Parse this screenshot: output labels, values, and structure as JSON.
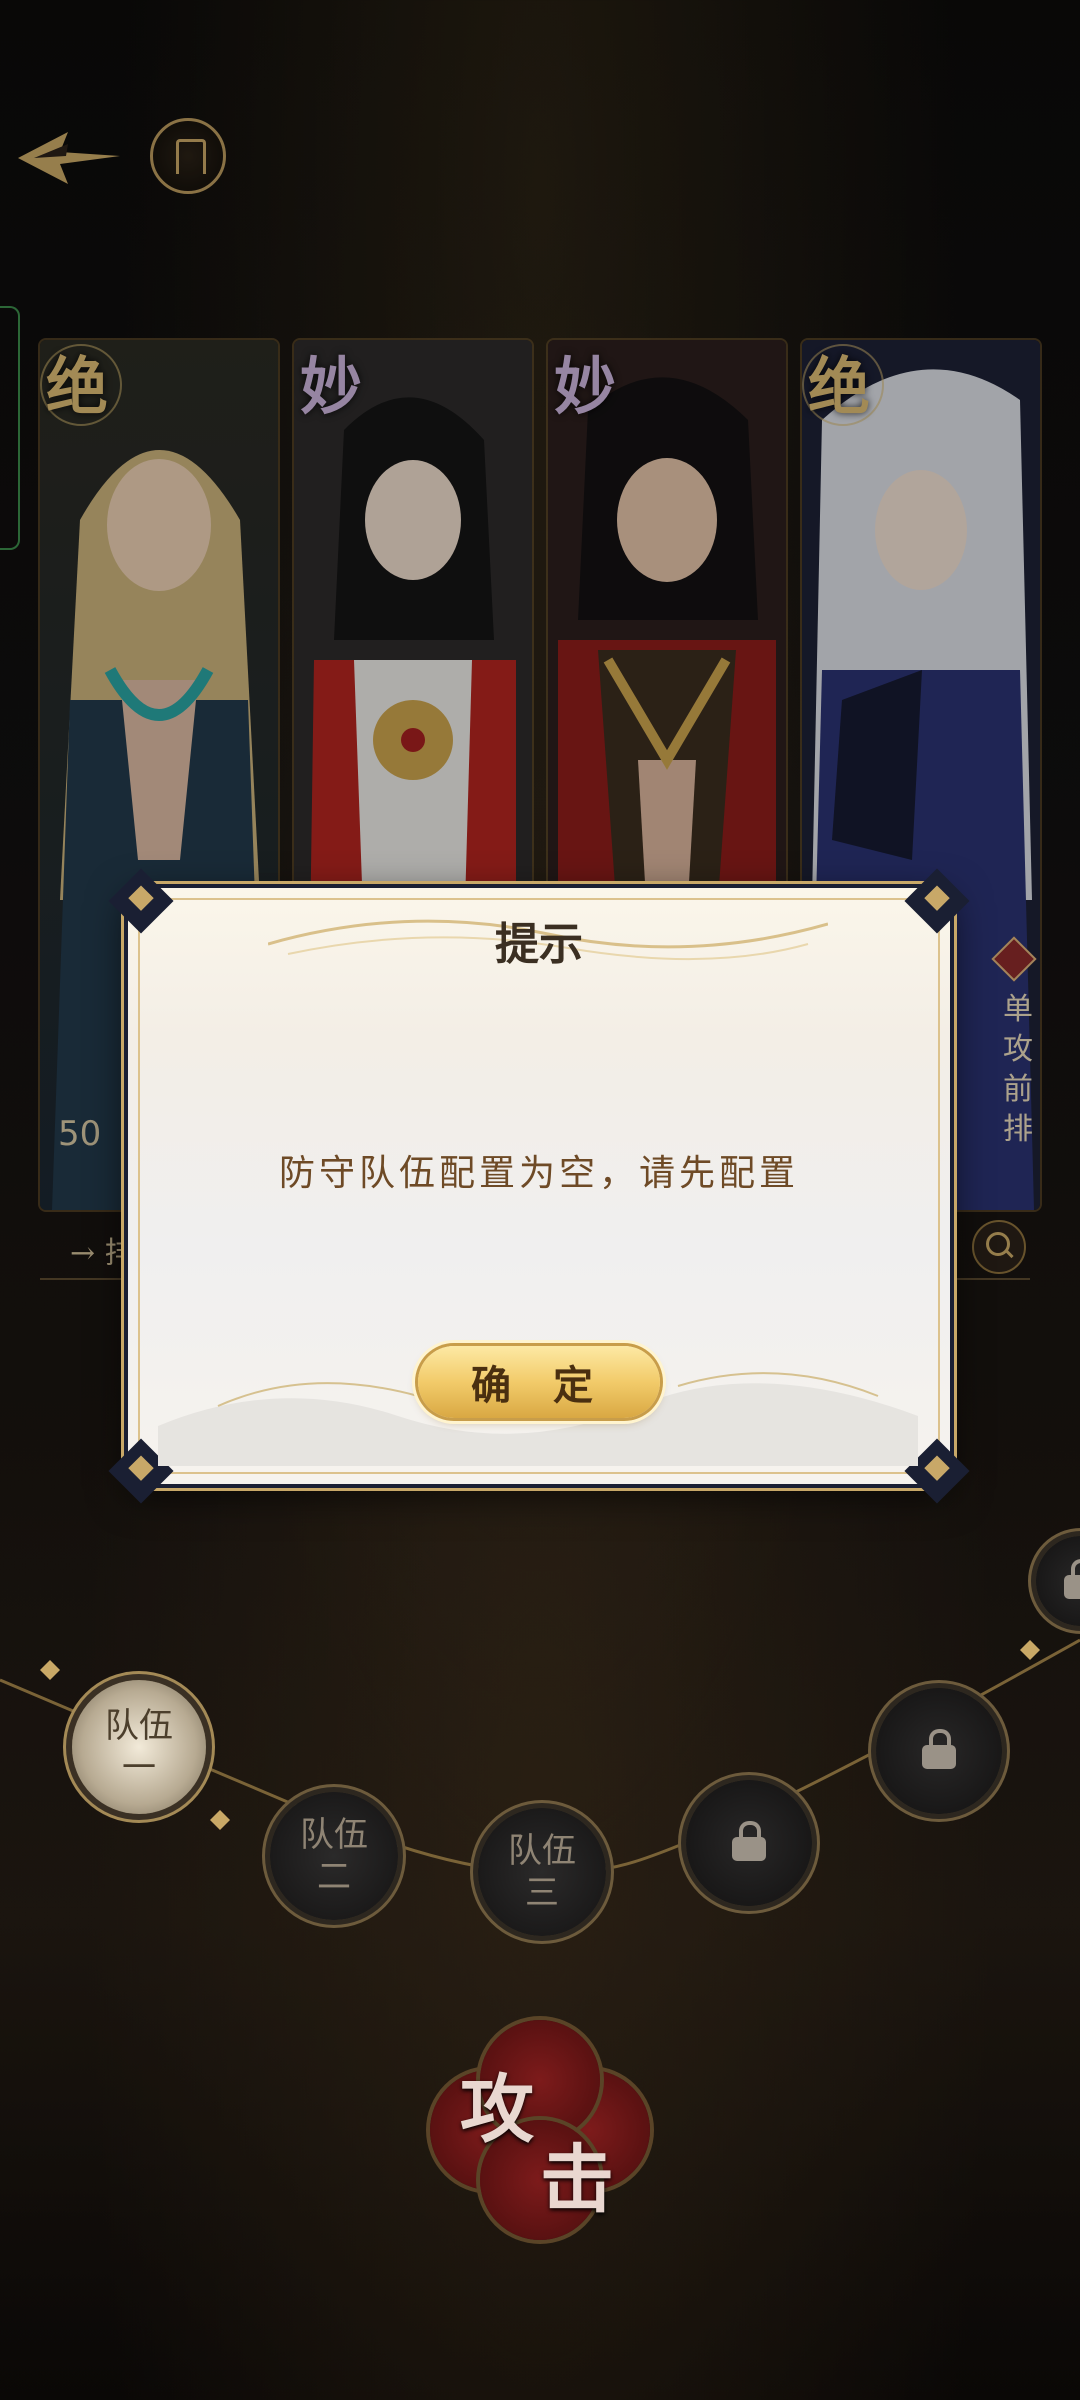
{
  "top_bar": {
    "back_icon": "back-arrow-icon",
    "gate_icon": "gate-icon"
  },
  "heroes": [
    {
      "rank": "绝",
      "level": "50",
      "role": ""
    },
    {
      "rank": "妙",
      "level": "",
      "role": ""
    },
    {
      "rank": "妙",
      "level": "",
      "role": ""
    },
    {
      "rank": "绝",
      "level": "",
      "role": "单攻前排"
    }
  ],
  "filter": {
    "label": "→ 排",
    "search_icon": "search-icon"
  },
  "dialog": {
    "title": "提示",
    "message": "防守队伍配置为空，请先配置",
    "confirm_label": "确 定"
  },
  "teams": [
    {
      "line1": "队伍",
      "line2": "一",
      "active": true
    },
    {
      "line1": "队伍",
      "line2": "二",
      "active": false
    },
    {
      "line1": "队伍",
      "line2": "三",
      "active": false
    }
  ],
  "locked_slot_icon": "lock-icon",
  "attack": {
    "char1": "攻",
    "char2": "击"
  },
  "colors": {
    "gold": "#c8a868",
    "dialog_text": "#6e4a26",
    "attack_red": "#7d1b1b"
  }
}
